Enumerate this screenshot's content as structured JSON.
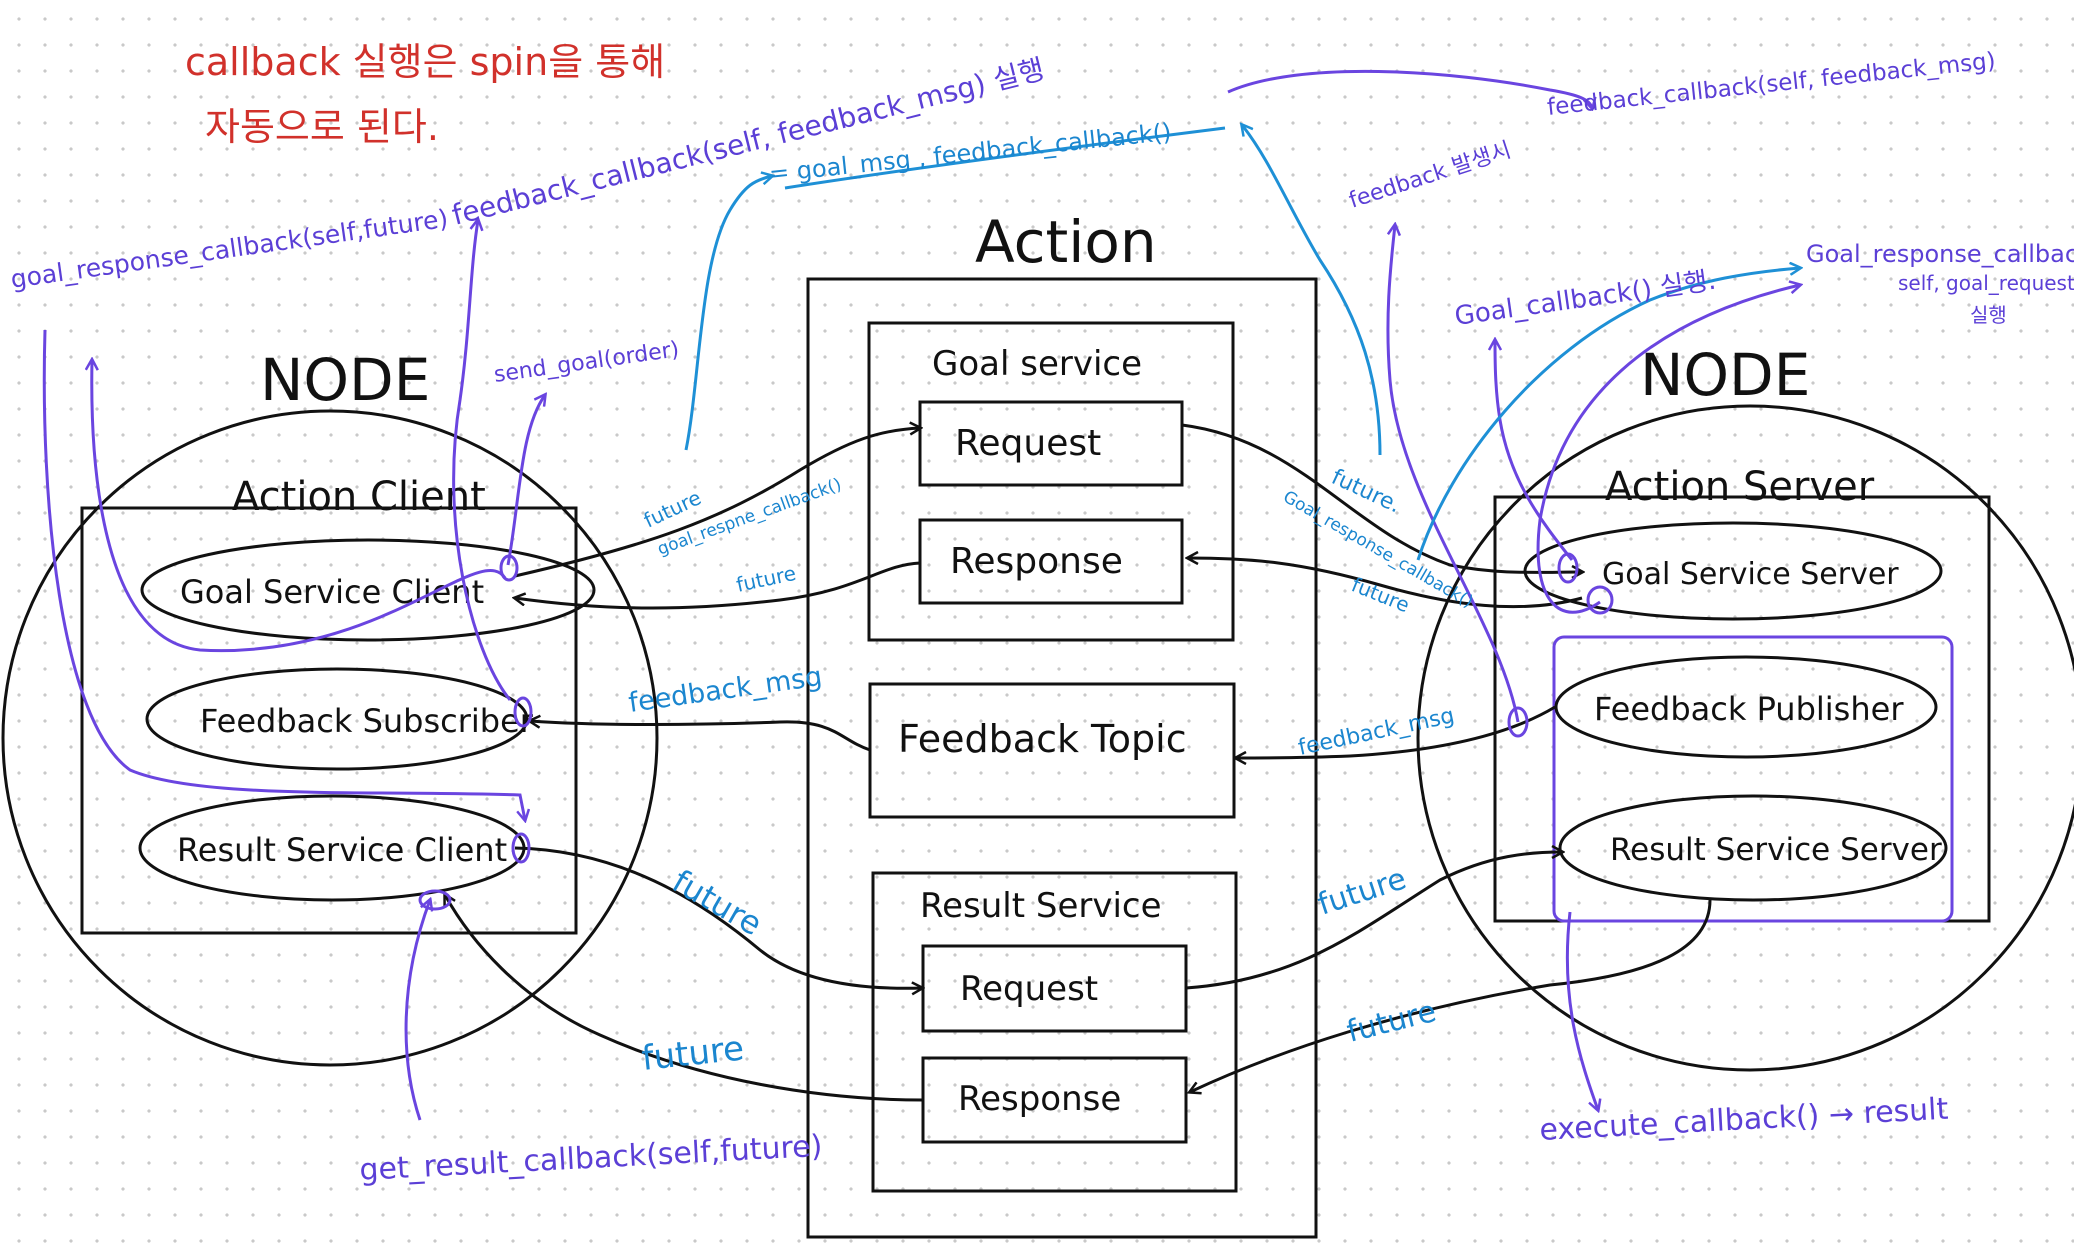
{
  "notes": {
    "red_line1": "callback 실행은 spin을 통해",
    "red_line2": "자동으로 된다."
  },
  "action": {
    "title": "Action",
    "goal_service": {
      "title": "Goal service",
      "request": "Request",
      "response": "Response"
    },
    "feedback_topic": "Feedback Topic",
    "result_service": {
      "title": "Result Service",
      "request": "Request",
      "response": "Response"
    }
  },
  "client": {
    "node_label": "NODE",
    "box_title": "Action Client",
    "goal": "Goal Service Client",
    "feedback": "Feedback Subscriber",
    "result": "Result Service Client"
  },
  "server": {
    "node_label": "NODE",
    "box_title": "Action Server",
    "goal": "Goal Service Server",
    "feedback": "Feedback Publisher",
    "result": "Result Service Server"
  },
  "purple_labels": {
    "goal_response_callback_left": "goal_response_callback(self,future)",
    "feedback_callback_top": "feedback_callback(self, feedback_msg) 실행",
    "send_goal": "send_goal(order)",
    "get_result_callback": "get_result_callback(self,future)",
    "feedback_callback_right": "feedback_callback(self, feedback_msg)",
    "feedback_occurs": "feedback 발생시",
    "goal_callback": "Goal_callback() 실행.",
    "goal_response_callback_right_1": "Goal_response_callback(",
    "goal_response_callback_right_2": "self, goal_request)",
    "goal_response_callback_right_3": "실행",
    "execute_callback": "execute_callback() → result"
  },
  "blue_labels": {
    "goal_msg": "= goal_msg , feedback_callback()",
    "future_goal_response_1": "future",
    "future_goal_response_2": "goal_respne_callback()",
    "future_response_left": "future",
    "feedback_msg_left": "feedback_msg",
    "future_result_req_left": "future",
    "future_result_resp_left": "future",
    "future_goal_right_1": "future.",
    "future_goal_right_2": "Goal_response_callback()",
    "future_goal_right_3": "future",
    "feedback_msg_right": "feedback_msg",
    "future_result_req_right": "future",
    "future_result_resp_right": "future"
  }
}
